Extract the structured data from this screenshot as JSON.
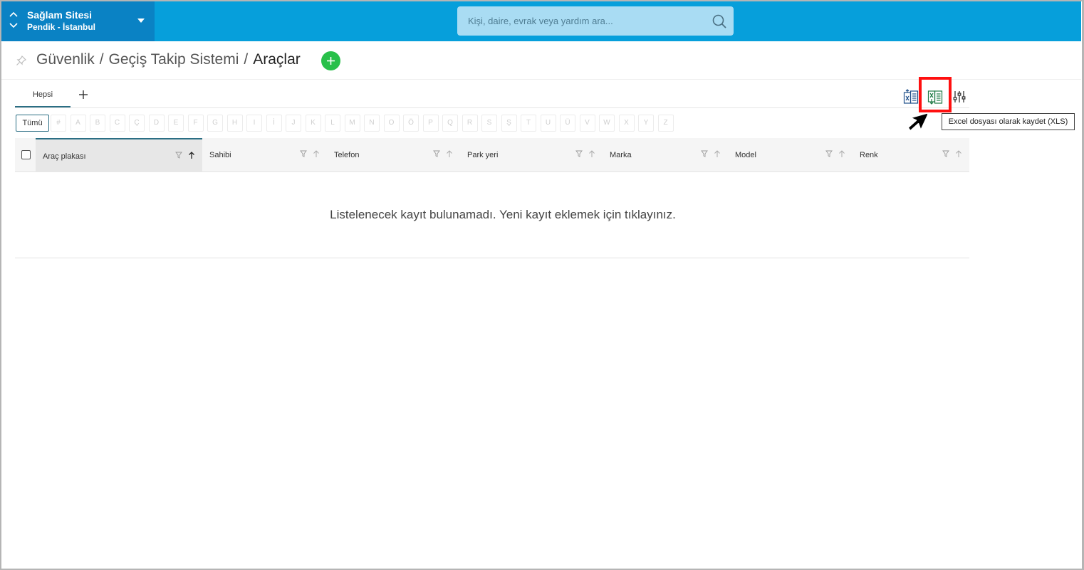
{
  "site": {
    "name": "Sağlam Sitesi",
    "location": "Pendik - İstanbul"
  },
  "search": {
    "placeholder": "Kişi, daire, evrak veya yardım ara..."
  },
  "breadcrumb": {
    "items": [
      "Güvenlik",
      "Geçiş Takip Sistemi"
    ],
    "current": "Araçlar",
    "separator": "/"
  },
  "tabs": [
    {
      "label": "Hepsi",
      "active": true
    }
  ],
  "tab_add_icon": "plus-icon",
  "letters": {
    "all_label": "Tümü",
    "items": [
      "#",
      "A",
      "B",
      "C",
      "Ç",
      "D",
      "E",
      "F",
      "G",
      "H",
      "I",
      "İ",
      "J",
      "K",
      "L",
      "M",
      "N",
      "O",
      "Ö",
      "P",
      "Q",
      "R",
      "S",
      "Ş",
      "T",
      "U",
      "Ü",
      "V",
      "W",
      "X",
      "Y",
      "Z"
    ]
  },
  "table": {
    "columns": [
      {
        "label": "Araç plakası",
        "sorted": "asc",
        "active": true
      },
      {
        "label": "Sahibi"
      },
      {
        "label": "Telefon"
      },
      {
        "label": "Park yeri"
      },
      {
        "label": "Marka"
      },
      {
        "label": "Model"
      },
      {
        "label": "Renk"
      }
    ],
    "empty_message": "Listelenecek kayıt bulunamadı. Yeni kayıt eklemek için tıklayınız."
  },
  "toolbar": {
    "icons": [
      "excel-import-icon",
      "excel-export-icon",
      "column-settings-icon"
    ],
    "tooltip": "Excel dosyası olarak kaydet (XLS)"
  },
  "colors": {
    "topbar": "#069fdb",
    "site_switcher": "#0a82c4",
    "accent": "#2b6e84",
    "add_button": "#29c04a",
    "highlight": "#ff1010",
    "excel_green": "#1f7a45"
  }
}
